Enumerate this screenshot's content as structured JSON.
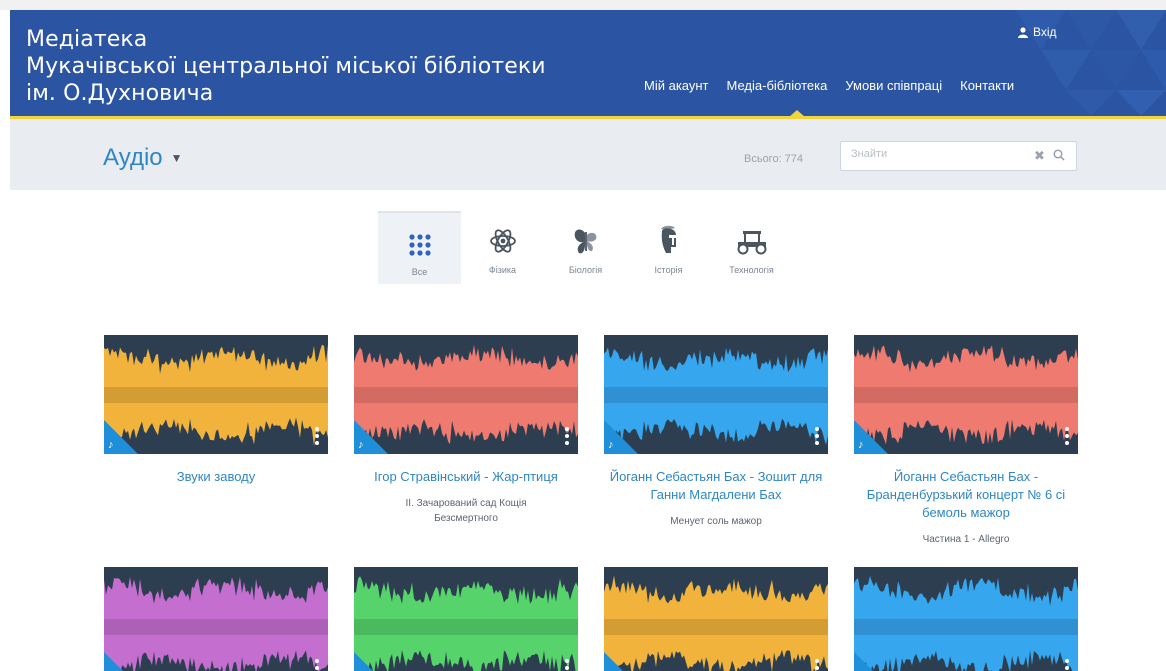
{
  "header": {
    "title_lines": [
      "Медіатека",
      "Мукачівської центральної міської бібліотеки",
      "ім. О.Духновича"
    ],
    "login_label": "Вхід",
    "nav": [
      "Мій акаунт",
      "Медіа-бібліотека",
      "Умови співпраці",
      "Контакти"
    ],
    "active_nav": "Медіа-бібліотека"
  },
  "subbar": {
    "section_title": "Аудіо",
    "total_label": "Всього: 774",
    "search_placeholder": "Знайти"
  },
  "categories": [
    {
      "label": "Все",
      "icon": "grid-icon",
      "active": true
    },
    {
      "label": "Фізика",
      "icon": "atom-icon",
      "active": false
    },
    {
      "label": "Біологія",
      "icon": "butterfly-icon",
      "active": false
    },
    {
      "label": "Історія",
      "icon": "helmet-icon",
      "active": false
    },
    {
      "label": "Технологія",
      "icon": "car-icon",
      "active": false
    }
  ],
  "items": [
    {
      "title": "Звуки заводу",
      "subtitle": "",
      "color": "#f1b33c"
    },
    {
      "title": "Ігор Стравінський - Жар-птиця",
      "subtitle": "II. Зачарований сад Кощія Безсмертного",
      "color": "#ef7a6f"
    },
    {
      "title": "Йоганн Себастьян Бах - Зошит для Ганни Магдалени Бах",
      "subtitle": "Менует соль мажор",
      "color": "#36a6ee"
    },
    {
      "title": "Йоганн Себастьян Бах - Бранденбурзький концерт № 6 сі бемоль мажор",
      "subtitle": "Частина 1 - Allegro",
      "color": "#ef7a6f"
    },
    {
      "title": "",
      "subtitle": "",
      "color": "#c46fd0"
    },
    {
      "title": "",
      "subtitle": "",
      "color": "#56d36a"
    },
    {
      "title": "",
      "subtitle": "",
      "color": "#f1b33c"
    },
    {
      "title": "",
      "subtitle": "",
      "color": "#36a6ee"
    }
  ],
  "colors": {
    "header_bg": "#2b54a2",
    "accent_yellow": "#f3d33a",
    "link_blue": "#2f86c5",
    "thumb_bg": "#2c3e4f"
  }
}
